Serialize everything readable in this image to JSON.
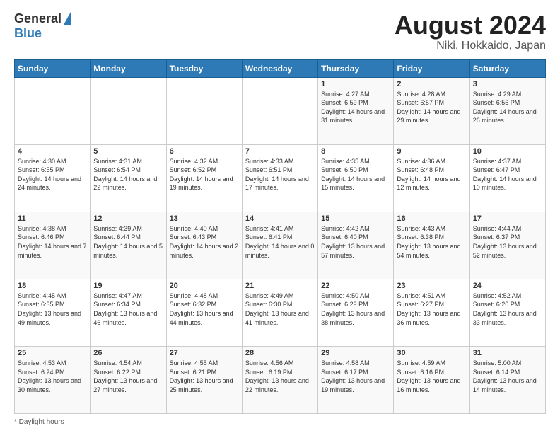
{
  "header": {
    "logo": {
      "general": "General",
      "blue": "Blue"
    },
    "title": "August 2024",
    "location": "Niki, Hokkaido, Japan"
  },
  "days_of_week": [
    "Sunday",
    "Monday",
    "Tuesday",
    "Wednesday",
    "Thursday",
    "Friday",
    "Saturday"
  ],
  "weeks": [
    [
      {
        "day": "",
        "info": ""
      },
      {
        "day": "",
        "info": ""
      },
      {
        "day": "",
        "info": ""
      },
      {
        "day": "",
        "info": ""
      },
      {
        "day": "1",
        "info": "Sunrise: 4:27 AM\nSunset: 6:59 PM\nDaylight: 14 hours and 31 minutes."
      },
      {
        "day": "2",
        "info": "Sunrise: 4:28 AM\nSunset: 6:57 PM\nDaylight: 14 hours and 29 minutes."
      },
      {
        "day": "3",
        "info": "Sunrise: 4:29 AM\nSunset: 6:56 PM\nDaylight: 14 hours and 26 minutes."
      }
    ],
    [
      {
        "day": "4",
        "info": "Sunrise: 4:30 AM\nSunset: 6:55 PM\nDaylight: 14 hours and 24 minutes."
      },
      {
        "day": "5",
        "info": "Sunrise: 4:31 AM\nSunset: 6:54 PM\nDaylight: 14 hours and 22 minutes."
      },
      {
        "day": "6",
        "info": "Sunrise: 4:32 AM\nSunset: 6:52 PM\nDaylight: 14 hours and 19 minutes."
      },
      {
        "day": "7",
        "info": "Sunrise: 4:33 AM\nSunset: 6:51 PM\nDaylight: 14 hours and 17 minutes."
      },
      {
        "day": "8",
        "info": "Sunrise: 4:35 AM\nSunset: 6:50 PM\nDaylight: 14 hours and 15 minutes."
      },
      {
        "day": "9",
        "info": "Sunrise: 4:36 AM\nSunset: 6:48 PM\nDaylight: 14 hours and 12 minutes."
      },
      {
        "day": "10",
        "info": "Sunrise: 4:37 AM\nSunset: 6:47 PM\nDaylight: 14 hours and 10 minutes."
      }
    ],
    [
      {
        "day": "11",
        "info": "Sunrise: 4:38 AM\nSunset: 6:46 PM\nDaylight: 14 hours and 7 minutes."
      },
      {
        "day": "12",
        "info": "Sunrise: 4:39 AM\nSunset: 6:44 PM\nDaylight: 14 hours and 5 minutes."
      },
      {
        "day": "13",
        "info": "Sunrise: 4:40 AM\nSunset: 6:43 PM\nDaylight: 14 hours and 2 minutes."
      },
      {
        "day": "14",
        "info": "Sunrise: 4:41 AM\nSunset: 6:41 PM\nDaylight: 14 hours and 0 minutes."
      },
      {
        "day": "15",
        "info": "Sunrise: 4:42 AM\nSunset: 6:40 PM\nDaylight: 13 hours and 57 minutes."
      },
      {
        "day": "16",
        "info": "Sunrise: 4:43 AM\nSunset: 6:38 PM\nDaylight: 13 hours and 54 minutes."
      },
      {
        "day": "17",
        "info": "Sunrise: 4:44 AM\nSunset: 6:37 PM\nDaylight: 13 hours and 52 minutes."
      }
    ],
    [
      {
        "day": "18",
        "info": "Sunrise: 4:45 AM\nSunset: 6:35 PM\nDaylight: 13 hours and 49 minutes."
      },
      {
        "day": "19",
        "info": "Sunrise: 4:47 AM\nSunset: 6:34 PM\nDaylight: 13 hours and 46 minutes."
      },
      {
        "day": "20",
        "info": "Sunrise: 4:48 AM\nSunset: 6:32 PM\nDaylight: 13 hours and 44 minutes."
      },
      {
        "day": "21",
        "info": "Sunrise: 4:49 AM\nSunset: 6:30 PM\nDaylight: 13 hours and 41 minutes."
      },
      {
        "day": "22",
        "info": "Sunrise: 4:50 AM\nSunset: 6:29 PM\nDaylight: 13 hours and 38 minutes."
      },
      {
        "day": "23",
        "info": "Sunrise: 4:51 AM\nSunset: 6:27 PM\nDaylight: 13 hours and 36 minutes."
      },
      {
        "day": "24",
        "info": "Sunrise: 4:52 AM\nSunset: 6:26 PM\nDaylight: 13 hours and 33 minutes."
      }
    ],
    [
      {
        "day": "25",
        "info": "Sunrise: 4:53 AM\nSunset: 6:24 PM\nDaylight: 13 hours and 30 minutes."
      },
      {
        "day": "26",
        "info": "Sunrise: 4:54 AM\nSunset: 6:22 PM\nDaylight: 13 hours and 27 minutes."
      },
      {
        "day": "27",
        "info": "Sunrise: 4:55 AM\nSunset: 6:21 PM\nDaylight: 13 hours and 25 minutes."
      },
      {
        "day": "28",
        "info": "Sunrise: 4:56 AM\nSunset: 6:19 PM\nDaylight: 13 hours and 22 minutes."
      },
      {
        "day": "29",
        "info": "Sunrise: 4:58 AM\nSunset: 6:17 PM\nDaylight: 13 hours and 19 minutes."
      },
      {
        "day": "30",
        "info": "Sunrise: 4:59 AM\nSunset: 6:16 PM\nDaylight: 13 hours and 16 minutes."
      },
      {
        "day": "31",
        "info": "Sunrise: 5:00 AM\nSunset: 6:14 PM\nDaylight: 13 hours and 14 minutes."
      }
    ]
  ],
  "footer": {
    "daylight_label": "Daylight hours"
  }
}
